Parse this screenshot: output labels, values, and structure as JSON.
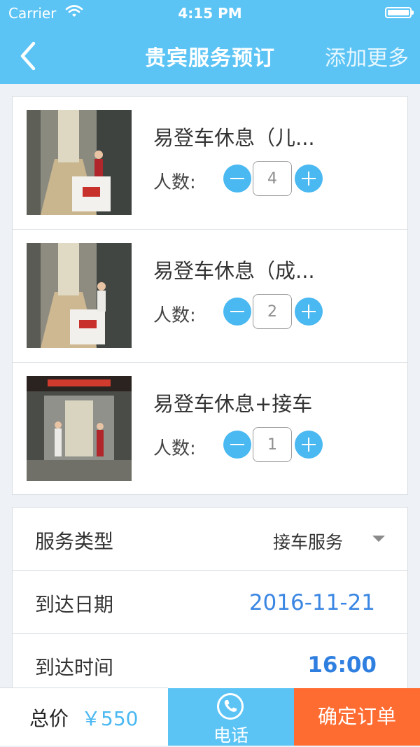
{
  "status_bar": {
    "carrier": "Carrier",
    "time": "4:15 PM",
    "icons": [
      "wifi-icon",
      "battery-icon"
    ]
  },
  "nav": {
    "back_icon": "chevron-left-icon",
    "title": "贵宾服务预订",
    "add_more": "添加更多"
  },
  "colors": {
    "primary": "#5bc4f5",
    "stepper": "#4ab8f1",
    "confirm": "#ff6c31",
    "link": "#3a86e3"
  },
  "items": [
    {
      "name": "易登车休息（儿...",
      "count_label": "人数:",
      "quantity": "4"
    },
    {
      "name": "易登车休息（成...",
      "count_label": "人数:",
      "quantity": "2"
    },
    {
      "name": "易登车休息+接车",
      "count_label": "人数:",
      "quantity": "1"
    }
  ],
  "form": {
    "service_type": {
      "label": "服务类型",
      "value": "接车服务"
    },
    "arrival_date": {
      "label": "到达日期",
      "value": "2016-11-21"
    },
    "arrival_time": {
      "label": "到达时间",
      "value": "16:00"
    }
  },
  "bottom": {
    "total_label": "总价",
    "total_value": "￥550",
    "phone_label": "电话",
    "confirm_label": "确定订单"
  }
}
